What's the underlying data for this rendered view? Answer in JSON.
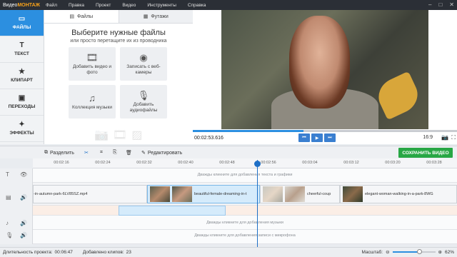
{
  "menubar": {
    "brand_prefix": "Видео",
    "brand_suffix": "МОНТАЖ",
    "items": [
      "Файл",
      "Правка",
      "Проект",
      "Видео",
      "Инструменты",
      "Справка"
    ]
  },
  "leftnav": {
    "items": [
      {
        "label": "ФАЙЛЫ",
        "icon": "folder-icon",
        "glyph": "▭"
      },
      {
        "label": "ТЕКСТ",
        "icon": "text-icon",
        "glyph": "T"
      },
      {
        "label": "КЛИПАРТ",
        "icon": "star-icon",
        "glyph": "★"
      },
      {
        "label": "ПЕРЕХОДЫ",
        "icon": "transitions-icon",
        "glyph": "▣"
      },
      {
        "label": "ЭФФЕКТЫ",
        "icon": "effects-icon",
        "glyph": "✦"
      }
    ]
  },
  "files_panel": {
    "tabs": [
      {
        "label": "Файлы",
        "icon": "files-icon"
      },
      {
        "label": "Футажи",
        "icon": "footage-icon"
      }
    ],
    "heading": "Выберите нужные файлы",
    "subheading": "или просто перетащите их из проводника",
    "tiles": [
      {
        "label": "Добавить видео и фото",
        "icon": "film-icon",
        "glyph": "🎞"
      },
      {
        "label": "Записать с веб-камеры",
        "icon": "webcam-icon",
        "glyph": "◉"
      },
      {
        "label": "Коллекция музыки",
        "icon": "music-icon",
        "glyph": "♫"
      },
      {
        "label": "Добавить аудиофайлы",
        "icon": "microphone-icon",
        "glyph": "🎙"
      }
    ]
  },
  "preview": {
    "timecode": "00:02:53.616",
    "ratio": "16:9",
    "progress": 0.42,
    "play_buttons": [
      "⏮",
      "▶",
      "⏭"
    ]
  },
  "toolbar": {
    "split_label": "Разделить",
    "edit_label": "Редактировать",
    "save_label": "СОХРАНИТЬ ВИДЕО"
  },
  "ruler": {
    "ticks": [
      "00:02:16",
      "00:02:24",
      "00:02:32",
      "00:02:40",
      "00:02:48",
      "00:02:56",
      "00:03:04",
      "00:03:12",
      "00:03:20",
      "00:03:28"
    ]
  },
  "timeline": {
    "text_hint": "Дважды кликните для добавления текста и графики",
    "music_hint": "Дважды кликните для добавления музыки",
    "mic_hint": "Дважды кликните для добавления записи с микрофона",
    "clips": [
      {
        "name": "-in-autumn-park-6LV85SZ.mp4",
        "selected": false
      },
      {
        "name": "beautiful-female-dreaming-in-t",
        "selected": true
      },
      {
        "name": "cheerful-coup",
        "selected": false
      },
      {
        "name": "elegant-woman-walking-in-a-park-8WG",
        "selected": false
      }
    ]
  },
  "status": {
    "duration_label": "Длительность проекта:",
    "duration": "00:06:47",
    "clips_label": "Добавлено клипов:",
    "clips_count": "23",
    "zoom_label": "Масштаб:",
    "zoom_value": "62%",
    "zoom": 0.62
  },
  "colors": {
    "accent": "#2c8fe0",
    "save": "#28a745",
    "menubar": "#2b2f36"
  }
}
